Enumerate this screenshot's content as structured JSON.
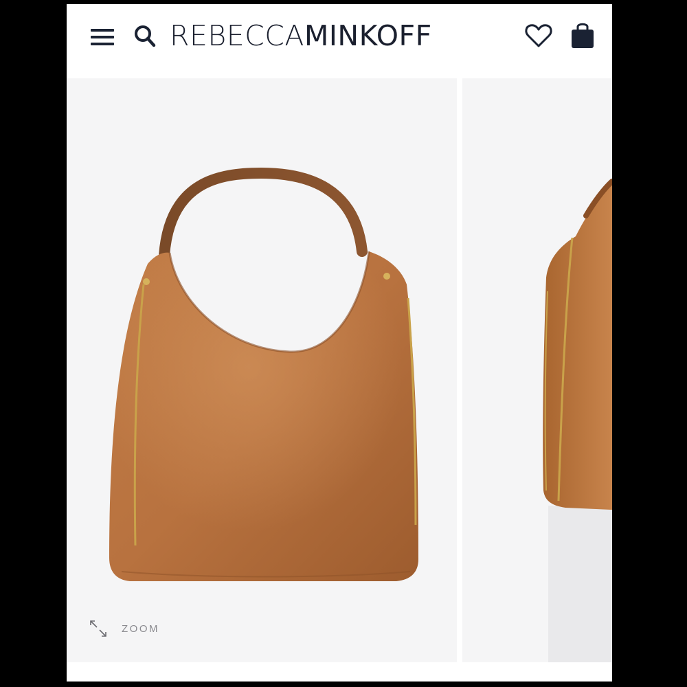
{
  "header": {
    "brand_part1": "REBECCA",
    "brand_part2": "MINKOFF",
    "icons": [
      "menu-icon",
      "search-icon",
      "heart-icon",
      "shopping-bag-icon"
    ]
  },
  "gallery": {
    "zoom_label": "ZOOM",
    "images": [
      {
        "name": "product-image-front",
        "alt": "Leather hobo bag, front view"
      },
      {
        "name": "product-image-side",
        "alt": "Leather hobo bag, side view"
      }
    ]
  },
  "colors": {
    "ink": "#1a1f2e",
    "leather": "#b06e3e",
    "background": "#f5f5f6"
  }
}
